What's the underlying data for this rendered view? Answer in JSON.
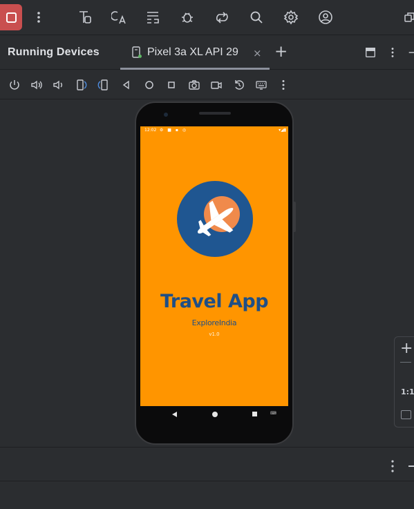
{
  "toolbar": {
    "stop_icon": "stop-icon",
    "more_icon": "vertical-ellipsis-icon",
    "icons": [
      "layout-inspector-icon",
      "translate-icon",
      "code-format-icon",
      "bug-icon",
      "sync-icon",
      "search-icon",
      "settings-icon",
      "account-icon",
      "window-restore-icon"
    ]
  },
  "panel": {
    "title": "Running Devices",
    "tab_label": "Pixel 3a XL API 29",
    "tab_close": "×",
    "add_tab": "+"
  },
  "device_toolbar": {
    "icons": [
      "power-icon",
      "volume-up-icon",
      "volume-down-icon",
      "rotate-left-icon",
      "rotate-right-icon",
      "back-icon",
      "home-icon",
      "overview-icon",
      "screenshot-icon",
      "screen-record-icon",
      "snapshot-icon",
      "keyboard-icon",
      "more-icon"
    ]
  },
  "phone": {
    "status_time": "12:02",
    "app_title": "Travel App",
    "app_subtitle": "ExploreIndia",
    "app_version": "v1.0"
  },
  "zoom": {
    "zoom_in": "+",
    "actual_size": "1:1"
  },
  "colors": {
    "stop_button": "#c94f4f",
    "splash_background": "#ff9500",
    "brand_blue": "#1f5691",
    "logo_accent": "#f08a4b"
  }
}
